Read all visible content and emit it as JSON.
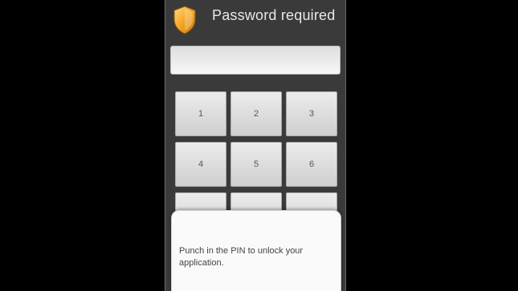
{
  "dialog": {
    "title": "Password required",
    "icon": "shield-icon",
    "accent_color": "#f5a623"
  },
  "pin_input": {
    "value": "",
    "placeholder": ""
  },
  "keypad": {
    "keys": [
      "1",
      "2",
      "3",
      "4",
      "5",
      "6",
      "",
      "",
      ""
    ]
  },
  "help": {
    "text": "Punch in the PIN to unlock your application."
  }
}
